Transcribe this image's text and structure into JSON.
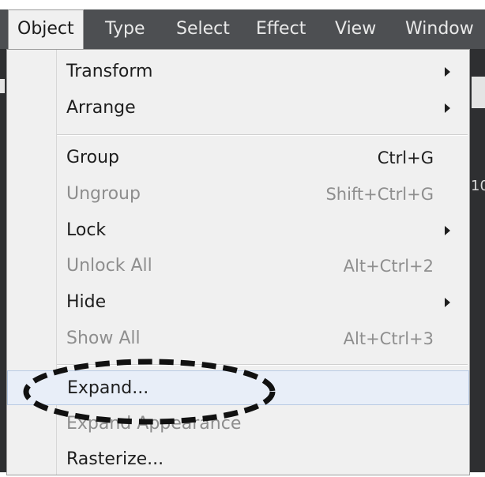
{
  "menubar": {
    "items": [
      {
        "label": "Object"
      },
      {
        "label": "Type"
      },
      {
        "label": "Select"
      },
      {
        "label": "Effect"
      },
      {
        "label": "View"
      },
      {
        "label": "Window"
      }
    ]
  },
  "background": {
    "partial_text": "10"
  },
  "dropdown": {
    "items": [
      {
        "label": "Transform",
        "shortcut": "",
        "submenu": true,
        "enabled": true
      },
      {
        "label": "Arrange",
        "shortcut": "",
        "submenu": true,
        "enabled": true
      },
      {
        "label": "Group",
        "shortcut": "Ctrl+G",
        "submenu": false,
        "enabled": true
      },
      {
        "label": "Ungroup",
        "shortcut": "Shift+Ctrl+G",
        "submenu": false,
        "enabled": false
      },
      {
        "label": "Lock",
        "shortcut": "",
        "submenu": true,
        "enabled": true
      },
      {
        "label": "Unlock All",
        "shortcut": "Alt+Ctrl+2",
        "submenu": false,
        "enabled": false
      },
      {
        "label": "Hide",
        "shortcut": "",
        "submenu": true,
        "enabled": true
      },
      {
        "label": "Show All",
        "shortcut": "Alt+Ctrl+3",
        "submenu": false,
        "enabled": false
      },
      {
        "label": "Expand...",
        "shortcut": "",
        "submenu": false,
        "enabled": true,
        "highlighted": true
      },
      {
        "label": "Expand Appearance",
        "shortcut": "",
        "submenu": false,
        "enabled": false
      },
      {
        "label": "Rasterize...",
        "shortcut": "",
        "submenu": false,
        "enabled": true
      }
    ]
  },
  "colors": {
    "menubar_bg": "#4d4f52",
    "menu_bg": "#f0f0f0",
    "highlight_bg": "#e8eef8",
    "disabled_text": "#8e8e8e",
    "annotation": "#111111"
  }
}
